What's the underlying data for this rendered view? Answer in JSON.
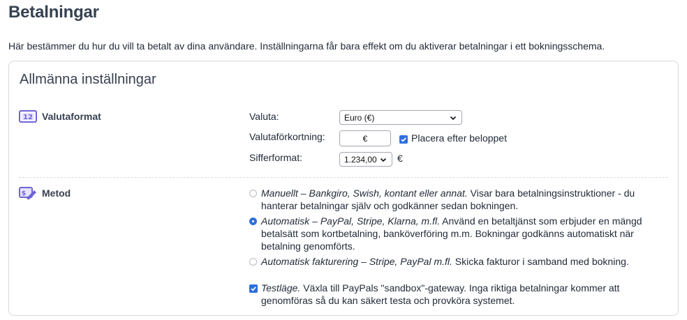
{
  "page": {
    "title": "Betalningar",
    "intro": "Här bestämmer du hur du vill ta betalt av dina användare. Inställningarna får bara effekt om du aktiverar betalningar i ett bokningsschema."
  },
  "card": {
    "title": "Allmänna inställningar"
  },
  "currency_section": {
    "label": "Valutaformat",
    "icon": "number-12-icon",
    "currency_label": "Valuta:",
    "currency_value": "Euro (€)",
    "abbrev_label": "Valutaförkortning:",
    "abbrev_value": "€",
    "after_amount_label": "Placera efter beloppet",
    "after_amount_checked": true,
    "number_format_label": "Sifferformat:",
    "number_format_value": "1.234,00",
    "number_format_suffix": "€"
  },
  "method_section": {
    "label": "Metod",
    "icon": "payment-edit-icon",
    "options": [
      {
        "title": "Manuellt – Bankgiro, Swish, kontant eller annat.",
        "description": " Visar bara betalningsinstruktioner - du hanterar betalningar själv och godkänner sedan bokningen.",
        "checked": false
      },
      {
        "title": "Automatisk – PayPal, Stripe, Klarna, m.fl.",
        "description": " Använd en betaltjänst som erbjuder en mängd betalsätt som kortbetalning, banköverföring m.m. Bokningar godkänns automatiskt när betalning genomförts.",
        "checked": true
      },
      {
        "title": "Automatisk fakturering – Stripe, PayPal m.fl.",
        "description": " Skicka fakturor i samband med bokning.",
        "checked": false
      }
    ],
    "test_mode": {
      "title": "Testläge.",
      "description": " Växla till PayPals \"sandbox\"-gateway. Inga riktiga betalningar kommer att genomföras så du kan säkert testa och provköra systemet.",
      "checked": true
    }
  },
  "colors": {
    "accent": "#2f6fdb",
    "icon_purple": "#6f63d9",
    "border": "#d6d9de"
  }
}
